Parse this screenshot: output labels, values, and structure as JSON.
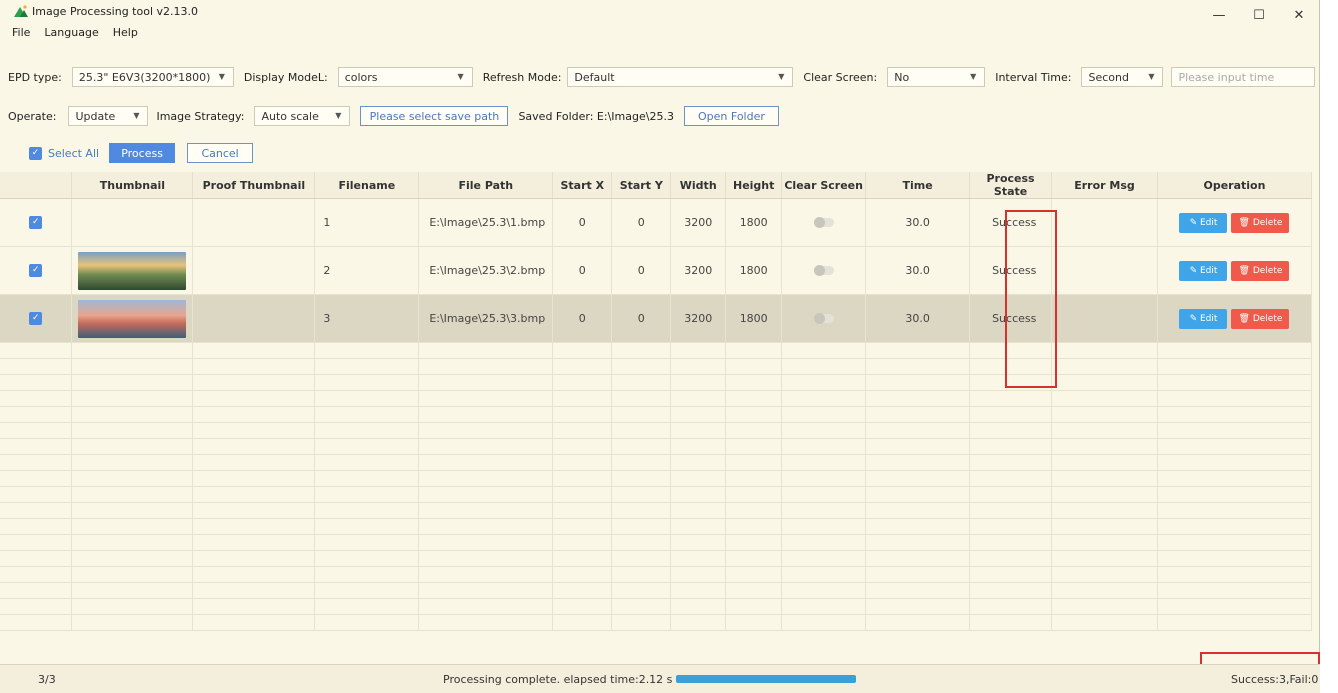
{
  "window": {
    "title": "Image Processing tool v2.13.0",
    "minimize": "—",
    "maximize": "☐",
    "close": "✕"
  },
  "menu": [
    "File",
    "Language",
    "Help"
  ],
  "toolbar1": {
    "epd_label": "EPD type:",
    "epd_value": "25.3\" E6V3(3200*1800)",
    "display_label": "Display ModeL:",
    "display_value": "colors",
    "refresh_label": "Refresh Mode:",
    "refresh_value": "Default",
    "clear_label": "Clear Screen:",
    "clear_value": "No",
    "interval_label": "Interval Time:",
    "interval_value": "Second",
    "time_placeholder": "Please input time"
  },
  "toolbar2": {
    "operate_label": "Operate:",
    "operate_value": "Update",
    "strategy_label": "Image Strategy:",
    "strategy_value": "Auto scale",
    "save_path_button": "Please select save path",
    "saved_folder": "Saved Folder: E:\\Image\\25.3",
    "open_folder_button": "Open Folder"
  },
  "toolbar3": {
    "select_all": "Select All",
    "process": "Process",
    "cancel": "Cancel"
  },
  "table": {
    "headers": [
      "",
      "Thumbnail",
      "Proof Thumbnail",
      "Filename",
      "File Path",
      "Start X",
      "Start Y",
      "Width",
      "Height",
      "Clear Screen",
      "Time",
      "Process State",
      "Error Msg",
      "Operation"
    ],
    "rows": [
      {
        "filename": "1",
        "path": "E:\\Image\\25.3\\1.bmp",
        "startx": "0",
        "starty": "0",
        "width": "3200",
        "height": "1800",
        "time": "30.0",
        "state": "Success",
        "error": ""
      },
      {
        "filename": "2",
        "path": "E:\\Image\\25.3\\2.bmp",
        "startx": "0",
        "starty": "0",
        "width": "3200",
        "height": "1800",
        "time": "30.0",
        "state": "Success",
        "error": ""
      },
      {
        "filename": "3",
        "path": "E:\\Image\\25.3\\3.bmp",
        "startx": "0",
        "starty": "0",
        "width": "3200",
        "height": "1800",
        "time": "30.0",
        "state": "Success",
        "error": ""
      }
    ],
    "edit_label": "Edit",
    "delete_label": "Delete"
  },
  "status": {
    "count": "3/3",
    "message": "Processing complete. elapsed time:2.12 s",
    "progress_percent": 100,
    "summary": "Success:3,Fail:0"
  },
  "colors": {
    "accent": "#4f8ae0",
    "delete": "#f05a4b",
    "edit": "#3fa4e8",
    "highlight_box": "#d82f2f"
  }
}
